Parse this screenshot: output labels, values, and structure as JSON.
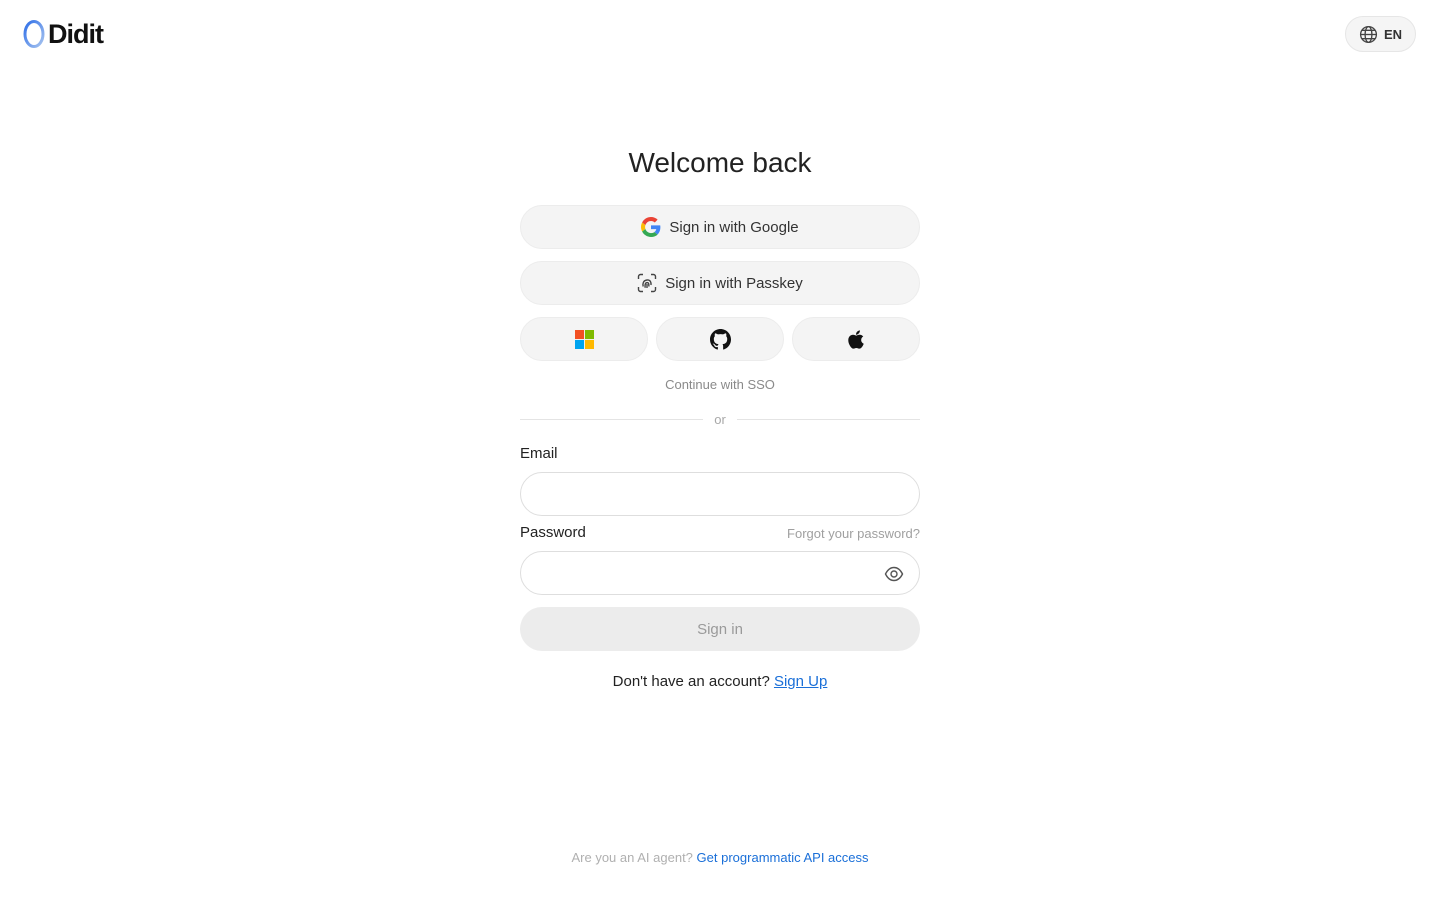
{
  "header": {
    "logo_text": "Didit",
    "language": "EN",
    "language_icon": "globe-icon"
  },
  "main": {
    "title": "Welcome back",
    "google_button": "Sign in with Google",
    "passkey_button": "Sign in with Passkey",
    "sso_icons": [
      "microsoft-icon",
      "github-icon",
      "apple-icon"
    ],
    "sso_link": "Continue with SSO",
    "divider_text": "or",
    "email_label": "Email",
    "email_value": "",
    "password_label": "Password",
    "password_value": "",
    "forgot_link": "Forgot your password?",
    "signin_button": "Sign in",
    "signup_prompt": "Don't have an account?",
    "signup_link": "Sign Up"
  },
  "footer": {
    "prompt": "Are you an AI agent?",
    "link": "Get programmatic API access"
  },
  "colors": {
    "link": "#1a6fd8",
    "button_bg": "#f4f4f4",
    "disabled_bg": "#ececec",
    "logo_gradient_start": "#3b82f6",
    "logo_gradient_end": "#9ab8e8"
  }
}
